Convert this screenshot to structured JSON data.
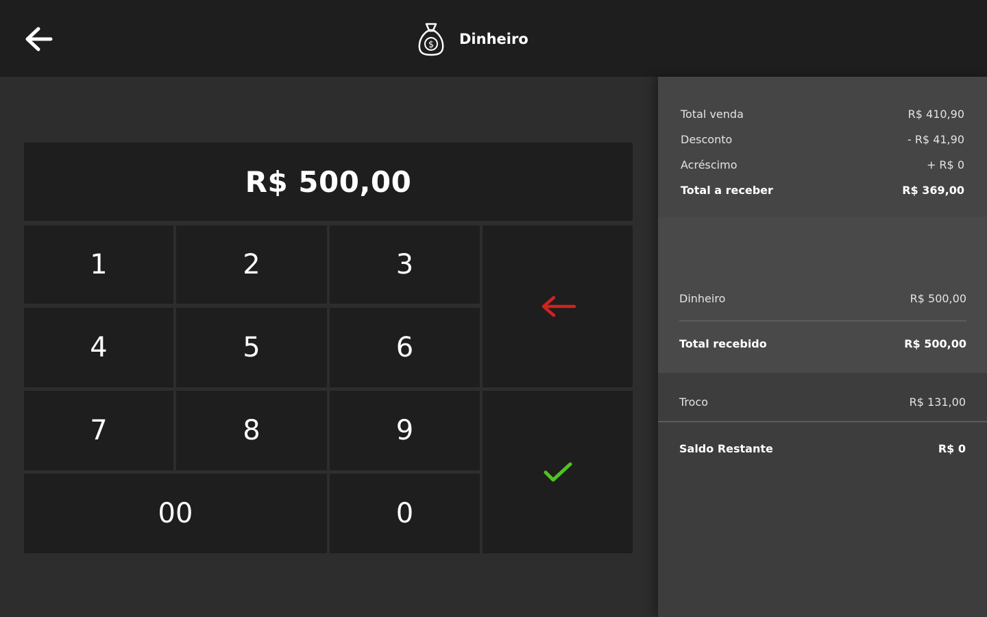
{
  "header": {
    "back_icon": "arrow-left-icon",
    "payment_icon": "money-bag-icon",
    "title": "Dinheiro"
  },
  "amount_display": "R$ 500,00",
  "keypad": {
    "keys": [
      "1",
      "2",
      "3",
      "4",
      "5",
      "6",
      "7",
      "8",
      "9",
      "00",
      "0"
    ],
    "backspace_icon": "backspace-arrow-icon",
    "confirm_icon": "checkmark-icon"
  },
  "summary": {
    "total_venda_label": "Total venda",
    "total_venda_value": "R$ 410,90",
    "desconto_label": "Desconto",
    "desconto_value": "- R$ 41,90",
    "acrescimo_label": "Acréscimo",
    "acrescimo_value": "+ R$ 0",
    "total_receber_label": "Total a receber",
    "total_receber_value": "R$ 369,00"
  },
  "received": {
    "dinheiro_label": "Dinheiro",
    "dinheiro_value": "R$ 500,00",
    "total_recebido_label": "Total recebido",
    "total_recebido_value": "R$ 500,00"
  },
  "change": {
    "troco_label": "Troco",
    "troco_value": "R$ 131,00",
    "saldo_label": "Saldo Restante",
    "saldo_value": "R$ 0"
  },
  "colors": {
    "header_bg": "#1e1e1e",
    "backspace": "#d0231f",
    "confirm": "#4fc41d"
  }
}
